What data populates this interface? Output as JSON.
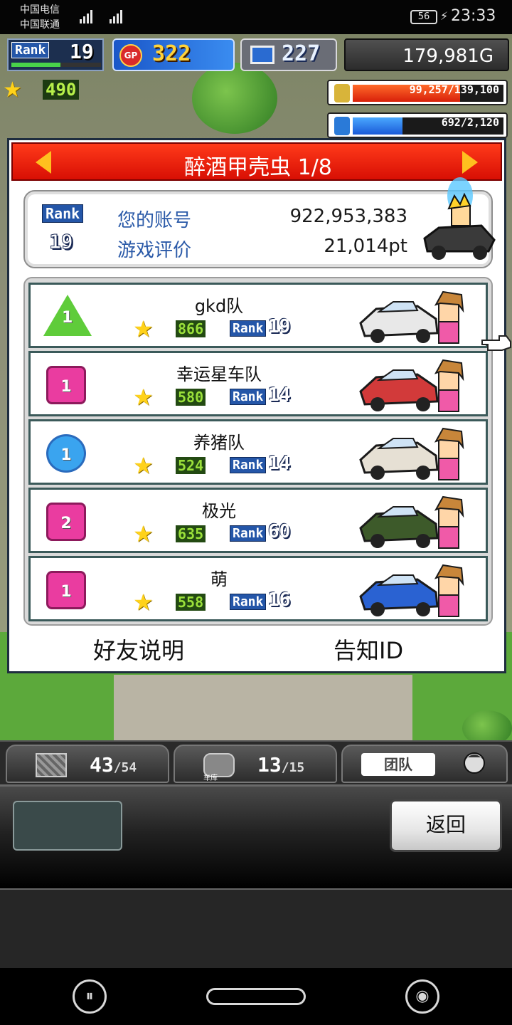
{
  "status_bar": {
    "carrier1": "中国电信",
    "carrier2": "中国联通",
    "battery": "56",
    "time": "23:33"
  },
  "hud": {
    "rank_label": "Rank",
    "rank": "19",
    "rank_progress": 0.55,
    "gp_icon": "GP",
    "gp": "322",
    "pc_points": "227",
    "money": "179,981G",
    "stars": "490",
    "resource1": {
      "text": "99,257/139,100",
      "fraction": 0.71
    },
    "resource2": {
      "text": "692/2,120",
      "fraction": 0.33
    }
  },
  "dialog": {
    "title": "醉酒甲壳虫 1/8",
    "info": {
      "rank_label": "Rank",
      "rank": "19",
      "account_label": "您的账号",
      "account_value": "922,953,383",
      "rating_label": "游戏评价",
      "rating_value": "21,014pt"
    },
    "teams": [
      {
        "badge_shape": "tri",
        "badge": "1",
        "name": "gkd队",
        "points": "866",
        "rank_label": "Rank",
        "rank": "19",
        "car_color": "#e8e8e8"
      },
      {
        "badge_shape": "pink",
        "badge": "1",
        "name": "幸运星车队",
        "points": "580",
        "rank_label": "Rank",
        "rank": "14",
        "car_color": "#d23a3a"
      },
      {
        "badge_shape": "blue",
        "badge": "1",
        "name": "养猪队",
        "points": "524",
        "rank_label": "Rank",
        "rank": "14",
        "car_color": "#e6e0d4"
      },
      {
        "badge_shape": "pink",
        "badge": "2",
        "name": "极光",
        "points": "635",
        "rank_label": "Rank",
        "rank": "60",
        "car_color": "#3d5a2a"
      },
      {
        "badge_shape": "pink",
        "badge": "1",
        "name": "萌",
        "points": "558",
        "rank_label": "Rank",
        "rank": "16",
        "car_color": "#2a62d2"
      }
    ],
    "footer_left": "好友说明",
    "footer_right": "告知ID"
  },
  "tabs": {
    "t1_count": "43",
    "t1_total": "/54",
    "t2_label": "车库",
    "t2_count": "13",
    "t2_total": "/15",
    "t3_label": "团队"
  },
  "panel": {
    "back_label": "返回"
  },
  "icons": {
    "star": "★",
    "nav_left": "⏸",
    "nav_right": "◉"
  }
}
